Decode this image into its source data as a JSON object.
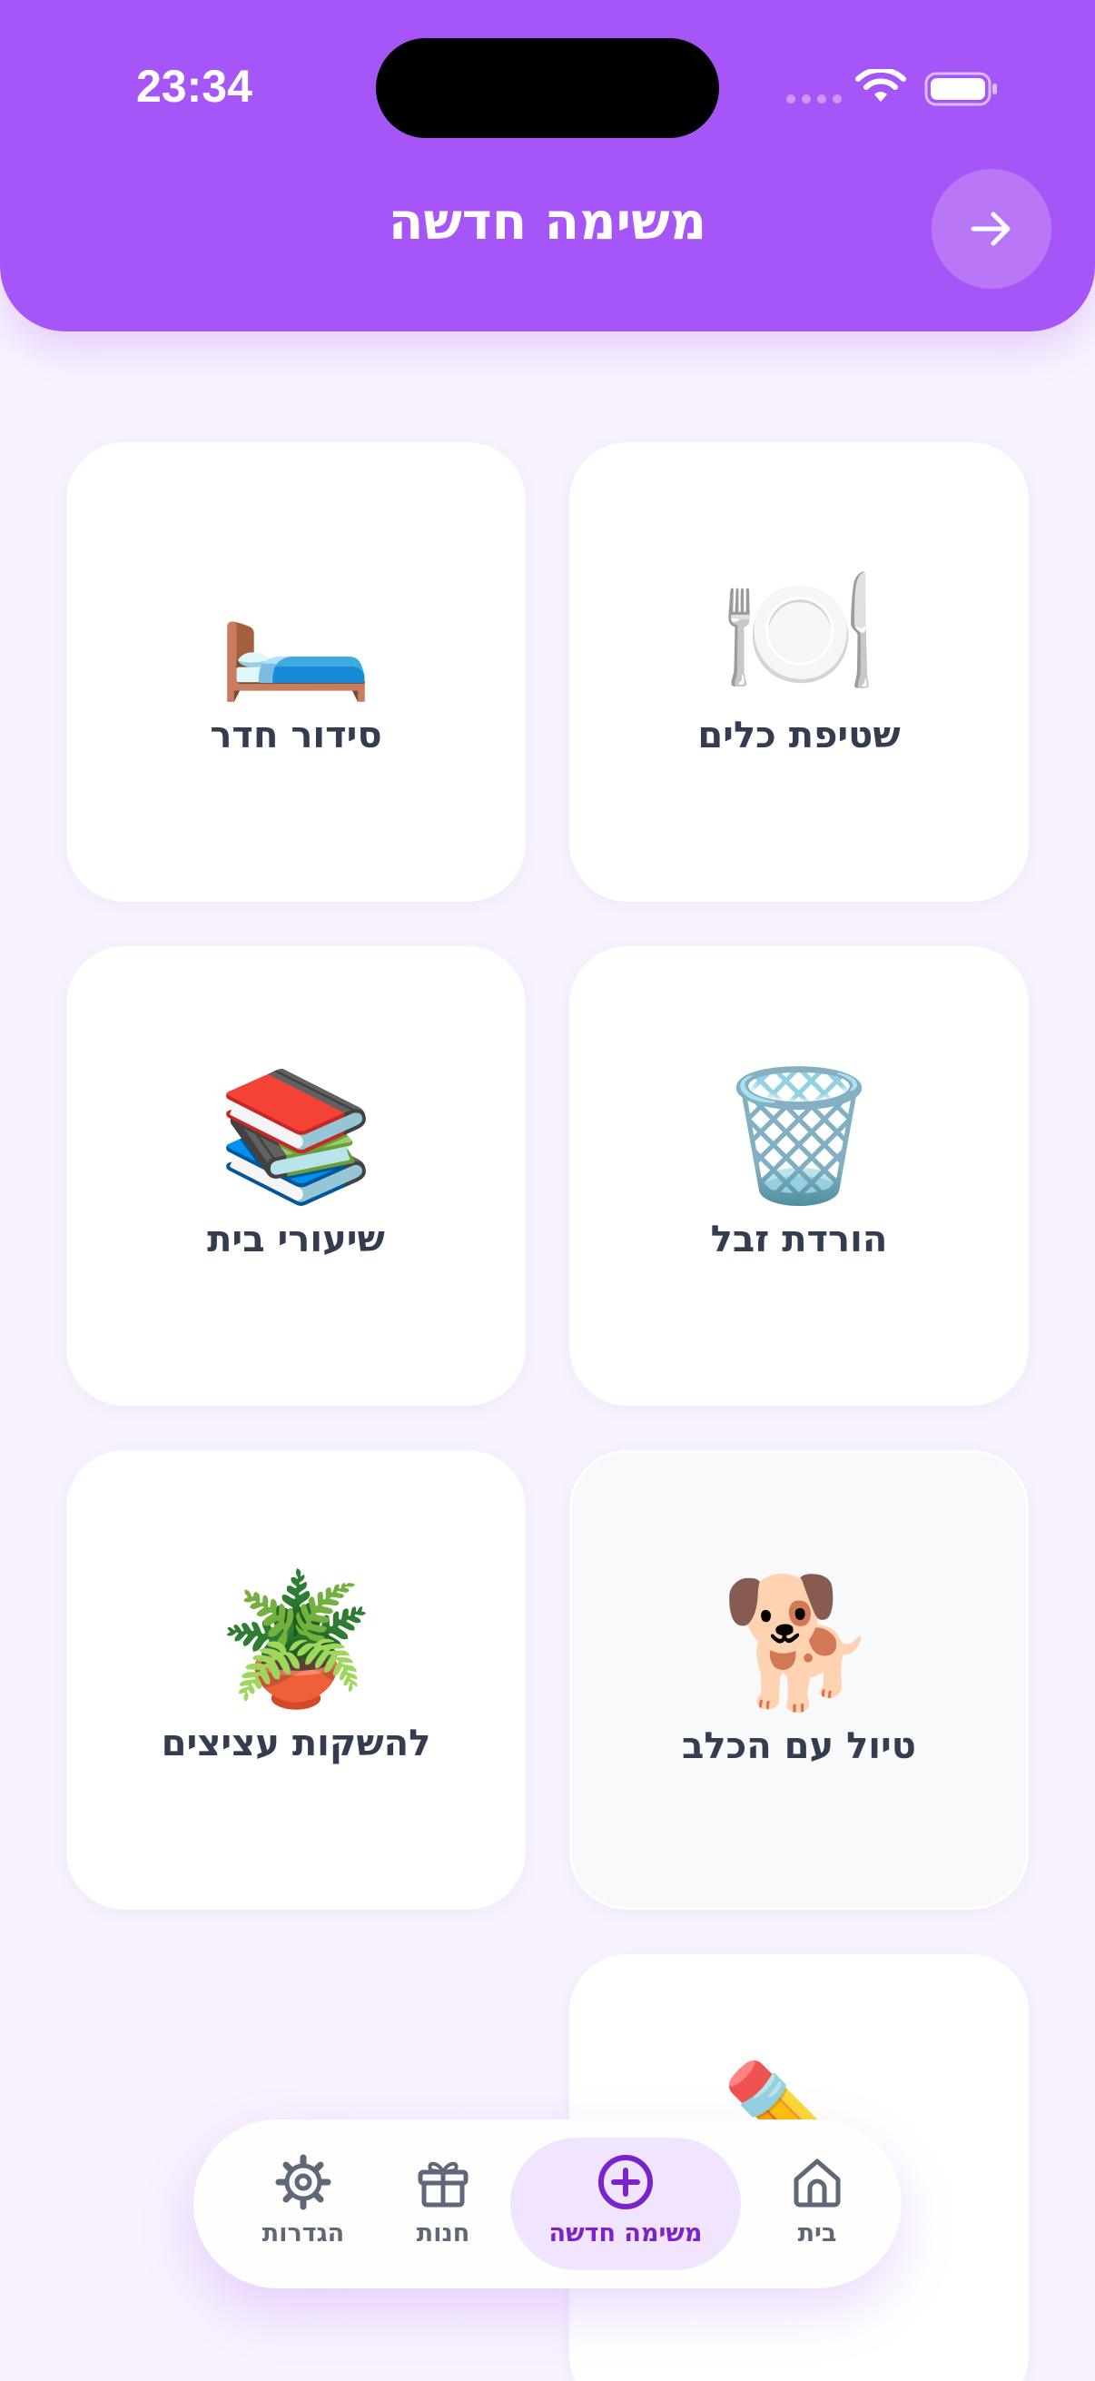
{
  "status_bar": {
    "time": "23:34"
  },
  "header": {
    "title": "משימה חדשה"
  },
  "tasks": [
    {
      "emoji": "🍽️",
      "label": "שטיפת כלים"
    },
    {
      "emoji": "🛏️",
      "label": "סידור חדר"
    },
    {
      "emoji": "🗑️",
      "label": "הורדת זבל"
    },
    {
      "emoji": "📚",
      "label": "שיעורי בית"
    },
    {
      "emoji": "🐕",
      "label": "טיול עם הכלב"
    },
    {
      "emoji": "🪴",
      "label": "להשקות עציצים"
    },
    {
      "emoji": "✏️",
      "label": ""
    }
  ],
  "nav": {
    "home": "בית",
    "new_task": "משימה חדשה",
    "shop": "חנות",
    "settings": "הגדרות"
  },
  "colors": {
    "primary": "#a656f6",
    "active": "#7a22cc",
    "background": "#f8f2fe"
  },
  "icons": {
    "back": "arrow-right-icon",
    "home": "home-icon",
    "new_task": "plus-circle-icon",
    "shop": "gift-icon",
    "settings": "gear-icon"
  }
}
